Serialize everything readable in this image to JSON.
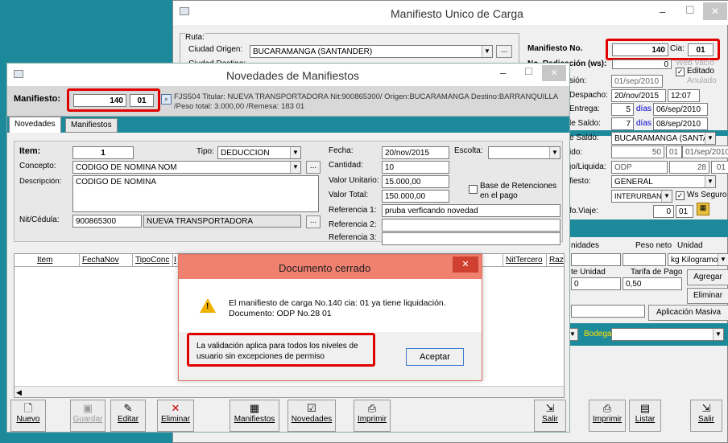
{
  "back": {
    "title": "Manifiesto Unico de Carga",
    "ruta_label": "Ruta:",
    "ciudad_origen_label": "Ciudad Origen:",
    "ciudad_origen": "BUCARAMANGA  (SANTANDER)",
    "ciudad_destino_label": "Ciudad Destino:",
    "manifiesto_no_label": "Manifiesto No.",
    "manifiesto_no": "140",
    "cia_label": "Cia:",
    "cia": "01",
    "radicacion_label": "No. Radicación (ws):",
    "radicacion": "0",
    "web_label": "Web Vacío",
    "editado_label": "Editado",
    "anulado_label": "Anulado",
    "fecha_radicacion_label": "sión:",
    "fecha_radicacion": "01/sep/2010",
    "despacho_label": "Despacho:",
    "despacho_fecha": "20/nov/2015",
    "despacho_hora": "12:07",
    "entrega_label": "Entrega:",
    "entrega_dias": "5",
    "entrega_fecha": "06/sep/2010",
    "saldo_label": "le Saldo:",
    "saldo_dias": "7",
    "saldo_fecha": "08/sep/2010",
    "dias_label": "días",
    "lugar_saldo_label": "e Saldo:",
    "lugar_saldo": "BUCARAMANGA  (SANTAND",
    "ido_label": "ido:",
    "ido_1": "50",
    "ido_2": "01",
    "ido_3": "01/sep/2010",
    "liquida_label": "jo/Liquida:",
    "liquida_1": "ODP",
    "liquida_2": "28",
    "liquida_3": "01",
    "fiesto_label": "fiesto:",
    "fiesto_value": "GENERAL",
    "interurbano": "INTERURBANO",
    "ws_seguro_label": "Ws Seguro",
    "info_viaje_label": "fo.Viaje:",
    "info_1": "0",
    "info_2": "01",
    "unidades_label": "nidades",
    "peso_neto_label": "Peso neto",
    "unidad_label": "Unidad",
    "unidad_value": "kg  Kilogramo",
    "te_unidad_label": "te Unidad",
    "tarifa_pago_label": "Tarifa de Pago",
    "tarifa_1": "0",
    "tarifa_2": "0,50",
    "agregar": "Agregar",
    "eliminar": "Eliminar",
    "aplicacion_masiva": "Aplicación Masiva",
    "bodega_label": "Bodega:",
    "imprimir": "Imprimir",
    "listar": "Listar",
    "salir": "Salir"
  },
  "nov": {
    "title": "Novedades de Manifiestos",
    "manifiesto_label": "Manifiesto:",
    "manifiesto": "140",
    "cia": "01",
    "info_line1": "FJS504 Titular: NUEVA TRANSPORTADORA Nit:900865300/ Origen:BUCARAMANGA Destino:BARRANQUILLA",
    "info_line2": "/Peso total: 3.000,00 /Remesa: 183 01",
    "tab_novedades": "Novedades",
    "tab_manifiestos": "Manifiestos",
    "item_label": "Item:",
    "item": "1",
    "tipo_label": "Tipo:",
    "tipo": "DEDUCCION",
    "concepto_label": "Concepto:",
    "concepto": "CODIGO DE NOMINA NOM",
    "descripcion_label": "Descripción:",
    "descripcion": "CODIGO DE NOMINA",
    "nit_label": "Nit/Cédula:",
    "nit": "900865300",
    "nit_nombre": "NUEVA TRANSPORTADORA",
    "fecha_label": "Fecha:",
    "fecha": "20/nov/2015",
    "escolta_label": "Escolta:",
    "cantidad_label": "Cantidad:",
    "cantidad": "10",
    "valor_unitario_label": "Valor Unitario:",
    "valor_unitario": "15.000,00",
    "valor_total_label": "Valor Total:",
    "valor_total": "150.000,00",
    "base_ret_label": "Base de Retenciones",
    "base_ret_label2": "en el pago",
    "ref1_label": "Referencia 1:",
    "ref1": "pruba verficando novedad",
    "ref2_label": "Referencia 2:",
    "ref3_label": "Referencia 3:",
    "ellipsis": "...",
    "cols": [
      "Item",
      "FechaNov",
      "TipoConc",
      "I",
      "NitTercero",
      "Raz"
    ],
    "toolbar": {
      "nuevo": "Nuevo",
      "guardar": "Guardar",
      "editar": "Editar",
      "eliminar": "Eliminar",
      "manifiestos": "Manifiestos",
      "novedades": "Novedades",
      "imprimir": "Imprimir",
      "salir": "Salir"
    }
  },
  "dialog": {
    "title": "Documento cerrado",
    "message_line1": "El manifiesto de carga No.140 cia: 01 ya tiene liquidación.",
    "message_line2": "Documento: ODP No.28 01",
    "note_line1": "La validación aplica para todos los niveles de",
    "note_line2": "usuario sin excepciones de permiso",
    "accept": "Aceptar"
  }
}
